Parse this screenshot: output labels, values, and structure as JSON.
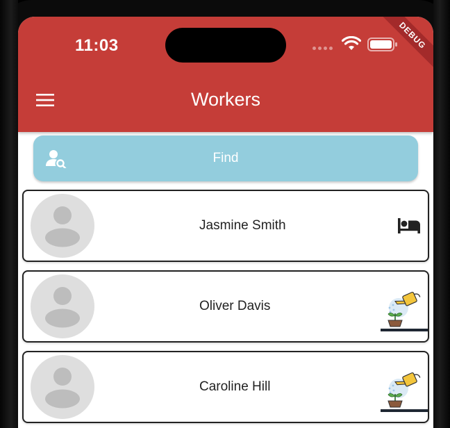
{
  "status_bar": {
    "time": "11:03",
    "debug_label": "DEBUG"
  },
  "appbar": {
    "title": "Workers",
    "menu_icon": "hamburger-menu-icon"
  },
  "find": {
    "label": "Find",
    "icon": "person-search-icon"
  },
  "workers": [
    {
      "name": "Jasmine Smith",
      "status_icon": "bed-icon"
    },
    {
      "name": "Oliver Davis",
      "status_icon": "watering-plant-icon"
    },
    {
      "name": "Caroline Hill",
      "status_icon": "watering-plant-icon"
    }
  ],
  "colors": {
    "appbar": "#c53d38",
    "find_button": "#93cddd",
    "card_border": "#222222",
    "avatar_bg": "#dedede"
  }
}
